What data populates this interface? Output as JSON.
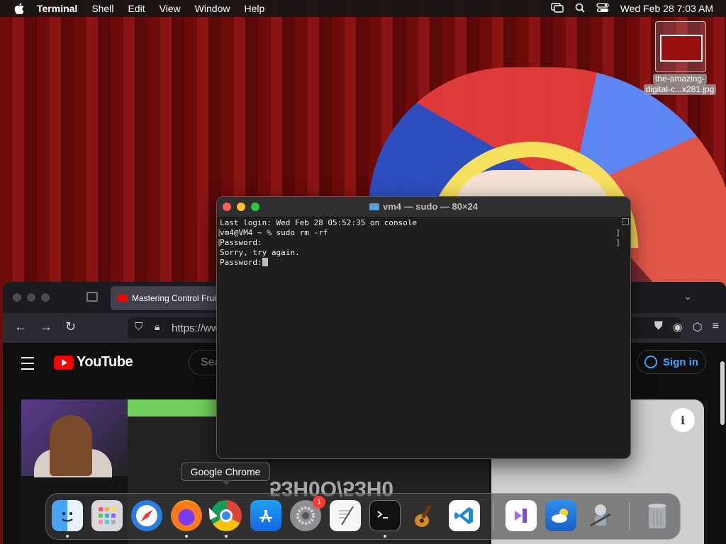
{
  "menubar": {
    "app_name": "Terminal",
    "items": [
      "Shell",
      "Edit",
      "View",
      "Window",
      "Help"
    ],
    "clock": "Wed Feb 28  7:03 AM"
  },
  "desktop": {
    "file_label_line1": "the-amazing-",
    "file_label_line2": "digital-c...x281.jpg"
  },
  "firefox": {
    "tab_title": "Mastering Control Frui",
    "url": "https://ww",
    "youtube_logo": "YouTube",
    "search_placeholder": "Sea",
    "sign_in": "Sign in",
    "info_icon": "i",
    "video_overlay_text": "53H0O/53H0"
  },
  "terminal": {
    "title": "vm4 — sudo — 80×24",
    "lines": [
      "Last login: Wed Feb 28 05:52:35 on console",
      "vm4@VM4 ~ % sudo rm -rf",
      "Password:",
      "Sorry, try again.",
      "Password:"
    ],
    "bracket_left_1": "[",
    "bracket_left_2": "[",
    "bracket_right_1": "]",
    "bracket_right_2": "]"
  },
  "tooltip": "Google Chrome",
  "dock": {
    "apps": [
      {
        "name": "Finder",
        "icon": "finder-icon",
        "running": true
      },
      {
        "name": "Launchpad",
        "icon": "launchpad-icon",
        "running": false
      },
      {
        "name": "Safari",
        "icon": "safari-icon",
        "running": false
      },
      {
        "name": "Firefox",
        "icon": "firefox-icon",
        "running": true
      },
      {
        "name": "Google Chrome",
        "icon": "chrome-icon",
        "running": true
      },
      {
        "name": "App Store",
        "icon": "app-store-icon",
        "running": false
      },
      {
        "name": "System Settings",
        "icon": "settings-icon",
        "running": false,
        "badge": "1"
      },
      {
        "name": "TextEdit",
        "icon": "textedit-icon",
        "running": false
      },
      {
        "name": "Terminal",
        "icon": "terminal-icon",
        "running": true
      },
      {
        "name": "GarageBand",
        "icon": "garageband-icon",
        "running": false
      },
      {
        "name": "Visual Studio Code",
        "icon": "vscode-icon",
        "running": false
      },
      {
        "name": "Visual Studio",
        "icon": "visual-studio-icon",
        "running": false
      },
      {
        "name": "Weather",
        "icon": "weather-icon",
        "running": false
      },
      {
        "name": "Automator",
        "icon": "automator-icon",
        "running": false
      },
      {
        "name": "Trash",
        "icon": "trash-icon",
        "running": false
      }
    ],
    "badge_count": "1"
  },
  "colors": {
    "menubar_bg": "#161616",
    "terminal_bg": "#1e1e1e",
    "traffic_red": "#ff5f57",
    "traffic_yellow": "#febc2e",
    "traffic_green": "#28c840",
    "youtube_red": "#ff0000",
    "link_blue": "#3ea6ff"
  }
}
